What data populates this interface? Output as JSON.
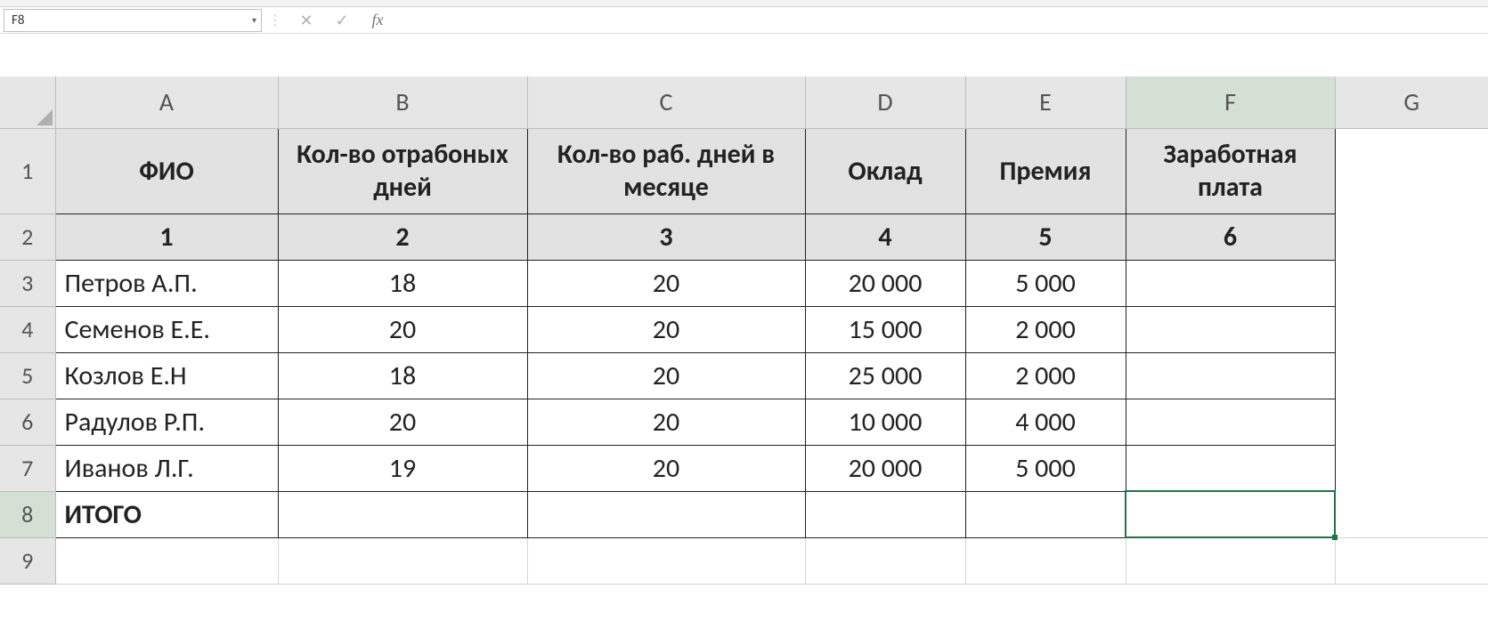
{
  "namebox": {
    "value": "F8"
  },
  "formula_bar": {
    "value": ""
  },
  "columns": [
    "A",
    "B",
    "C",
    "D",
    "E",
    "F",
    "G"
  ],
  "rows": [
    "1",
    "2",
    "3",
    "4",
    "5",
    "6",
    "7",
    "8",
    "9"
  ],
  "headers": {
    "A": "ФИО",
    "B": "Кол-во отрабоных дней",
    "C": "Кол-во раб. дней в месяце",
    "D": "Оклад",
    "E": "Премия",
    "F": "Заработная плата"
  },
  "subheaders": {
    "A": "1",
    "B": "2",
    "C": "3",
    "D": "4",
    "E": "5",
    "F": "6"
  },
  "data": [
    {
      "fio": "Петров А.П.",
      "days": "18",
      "work": "20",
      "salary": "20 000",
      "bonus": "5 000",
      "total": ""
    },
    {
      "fio": "Семенов Е.Е.",
      "days": "20",
      "work": "20",
      "salary": "15 000",
      "bonus": "2 000",
      "total": ""
    },
    {
      "fio": "Козлов Е.Н",
      "days": "18",
      "work": "20",
      "salary": "25 000",
      "bonus": "2 000",
      "total": ""
    },
    {
      "fio": "Радулов Р.П.",
      "days": "20",
      "work": "20",
      "salary": "10 000",
      "bonus": "4 000",
      "total": ""
    },
    {
      "fio": "Иванов Л.Г.",
      "days": "19",
      "work": "20",
      "salary": "20 000",
      "bonus": "5 000",
      "total": ""
    }
  ],
  "total_row": {
    "label": "ИТОГО"
  },
  "selection": {
    "cell": "F8",
    "col": "F",
    "row": "8"
  },
  "chart_data": {
    "type": "table",
    "title": "Заработная плата",
    "columns": [
      "ФИО",
      "Кол-во отрабоных дней",
      "Кол-во раб. дней в месяце",
      "Оклад",
      "Премия",
      "Заработная плата"
    ],
    "rows": [
      [
        "Петров А.П.",
        18,
        20,
        20000,
        5000,
        null
      ],
      [
        "Семенов Е.Е.",
        20,
        20,
        15000,
        2000,
        null
      ],
      [
        "Козлов Е.Н",
        18,
        20,
        25000,
        2000,
        null
      ],
      [
        "Радулов Р.П.",
        20,
        20,
        10000,
        4000,
        null
      ],
      [
        "Иванов Л.Г.",
        19,
        20,
        20000,
        5000,
        null
      ]
    ]
  }
}
